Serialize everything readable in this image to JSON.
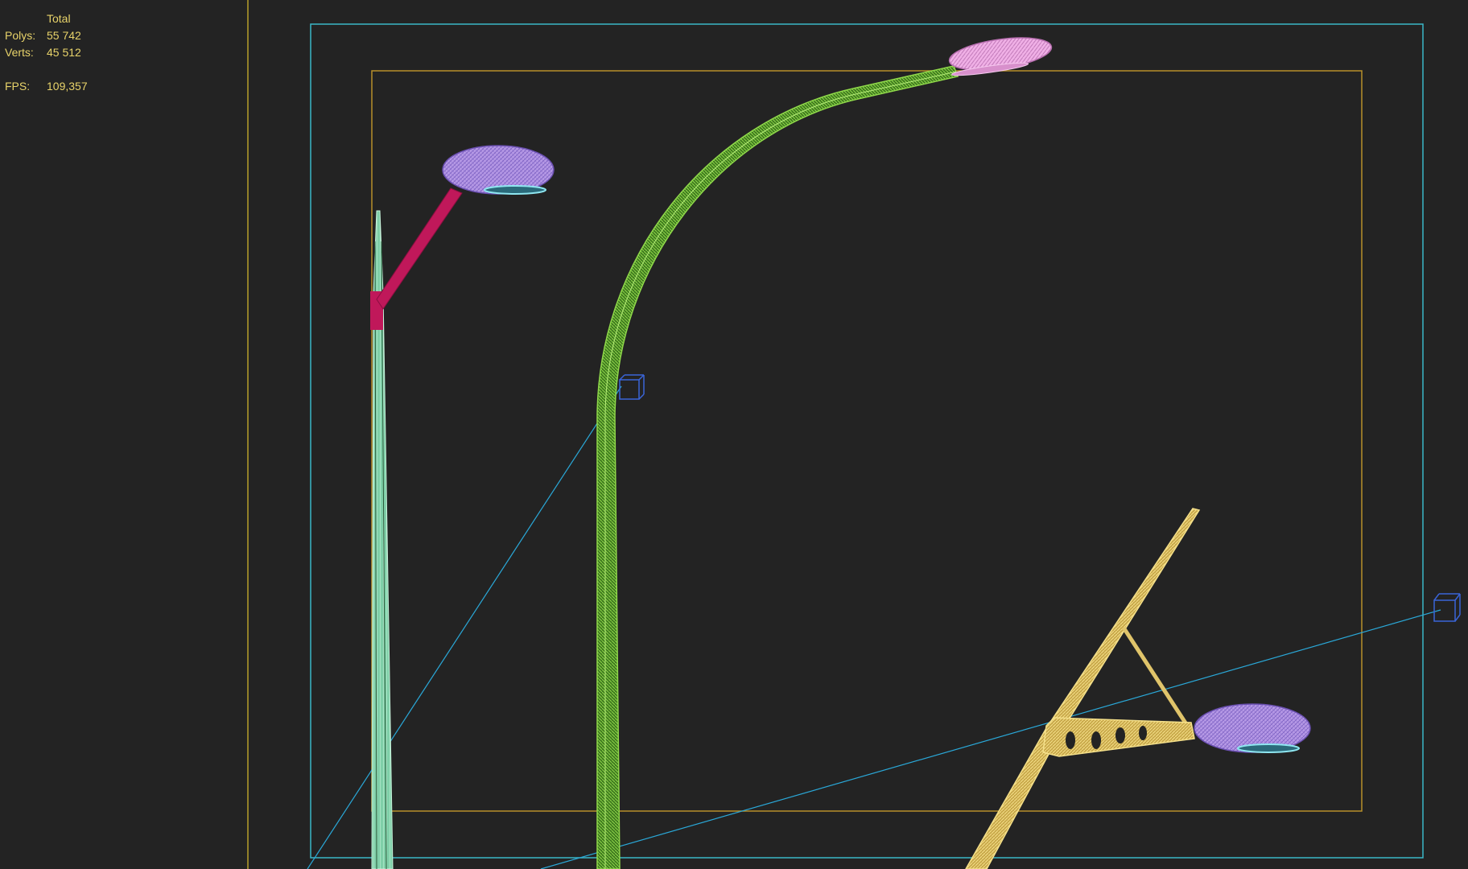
{
  "stats": {
    "header": "Total",
    "polys": {
      "label": "Polys:",
      "value": "55 742"
    },
    "verts": {
      "label": "Verts:",
      "value": "45 512"
    },
    "fps": {
      "label": "FPS:",
      "value": "109,357"
    }
  },
  "scene": {
    "objects": [
      {
        "name": "tapered-pole-lamp",
        "pole_color": "#9fe3c2",
        "arm_color": "#c0185a",
        "head_color": "#b79ae6"
      },
      {
        "name": "curved-pole-lamp",
        "pole_color": "#6fb83a",
        "head_color": "#e69ad6"
      },
      {
        "name": "angled-pole-lamp",
        "pole_color": "#e0c46a",
        "head_color": "#b79ae6"
      }
    ],
    "colors": {
      "background": "#232323",
      "safe_frame_outer": "#3ab8c8",
      "safe_frame_inner": "#b8902a",
      "viewport_divider": "#b8a02a",
      "camera": "#3a64d8",
      "camera_line": "#2aa8d8",
      "stats_text": "#e8d36a"
    }
  }
}
